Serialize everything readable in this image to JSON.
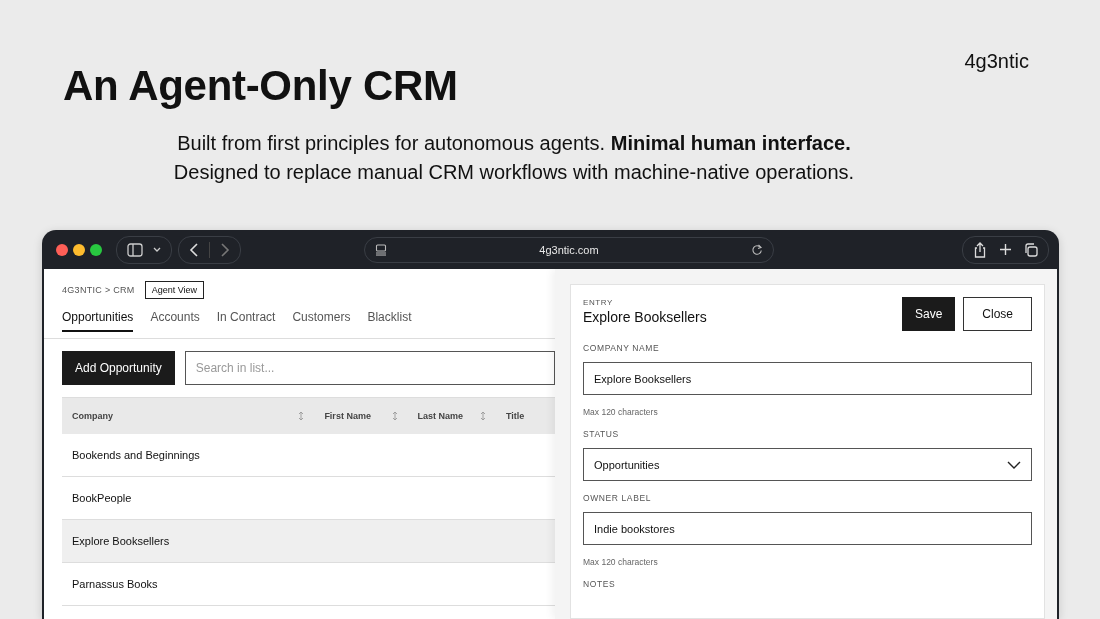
{
  "slide": {
    "title": "An Agent-Only CRM",
    "brand": "4g3ntic",
    "subtitle": [
      "Built from first principles for autonomous agents. **Minimal human interface.**",
      "Designed to replace manual CRM workflows with machine-native operations."
    ]
  },
  "browser": {
    "url": "4g3ntic.com"
  },
  "app": {
    "breadcrumb": "4G3NTIC > CRM",
    "view_badge": "Agent View",
    "tabs": [
      {
        "label": "Opportunities",
        "selected": true
      },
      {
        "label": "Accounts",
        "selected": false
      },
      {
        "label": "In Contract",
        "selected": false
      },
      {
        "label": "Customers",
        "selected": false
      },
      {
        "label": "Blacklist",
        "selected": false
      }
    ],
    "add_button": "Add Opportunity",
    "search": {
      "placeholder": "Search in list..."
    },
    "table": {
      "columns": [
        {
          "label": "Company",
          "sortable": true
        },
        {
          "label": "First Name",
          "sortable": true
        },
        {
          "label": "Last Name",
          "sortable": true
        },
        {
          "label": "Title",
          "sortable": false
        }
      ],
      "rows": [
        {
          "company": "Bookends and Beginnings",
          "selected": false
        },
        {
          "company": "BookPeople",
          "selected": false
        },
        {
          "company": "Explore Booksellers",
          "selected": true
        },
        {
          "company": "Parnassus Books",
          "selected": false
        }
      ]
    }
  },
  "drawer": {
    "eyebrow": "ENTRY",
    "title": "Explore Booksellers",
    "buttons": [
      {
        "label": "Save",
        "kind": "primary"
      },
      {
        "label": "Close",
        "kind": "secondary"
      }
    ],
    "fields": [
      {
        "label": "COMPANY NAME",
        "kind": "text",
        "value": "Explore Booksellers",
        "hint": "Max 120 characters"
      },
      {
        "label": "STATUS",
        "kind": "select",
        "value": "Opportunities"
      },
      {
        "label": "OWNER LABEL",
        "kind": "text",
        "value": "Indie bookstores",
        "hint": "Max 120 characters"
      },
      {
        "label": "NOTES",
        "kind": "heading"
      }
    ]
  }
}
